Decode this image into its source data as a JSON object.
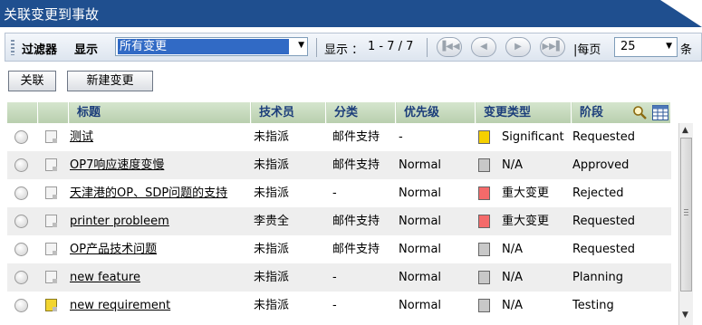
{
  "title": "关联变更到事故",
  "toolbar": {
    "filter_label": "过滤器",
    "show_label": "显示",
    "filter_value": "所有变更",
    "range_label": "显示 ：",
    "range_value": "1 - 7 / 7",
    "per_page_label": "|每页",
    "per_page_value": "25",
    "per_page_suffix": "条"
  },
  "actions": {
    "associate": "关联",
    "new_change": "新建变更"
  },
  "table": {
    "columns": [
      "标题",
      "技术员",
      "分类",
      "优先级",
      "变更类型",
      "阶段"
    ],
    "rows": [
      {
        "title": "测试",
        "tech": "未指派",
        "category": "邮件支持",
        "priority": "-",
        "type": "Significant",
        "type_color": "#f5d000",
        "stage": "Requested",
        "note": "plain"
      },
      {
        "title": "OP7响应速度变慢",
        "tech": "未指派",
        "category": "邮件支持",
        "priority": "Normal",
        "type": "N/A",
        "type_color": "#c8c8c8",
        "stage": "Approved",
        "note": "plain"
      },
      {
        "title": "天津港的OP、SDP问题的支持",
        "tech": "未指派",
        "category": "-",
        "priority": "Normal",
        "type": "重大变更",
        "type_color": "#f46a6a",
        "stage": "Rejected",
        "note": "plain"
      },
      {
        "title": "printer probleem",
        "tech": "李贵全",
        "category": "邮件支持",
        "priority": "Normal",
        "type": "重大变更",
        "type_color": "#f46a6a",
        "stage": "Requested",
        "note": "plain"
      },
      {
        "title": "OP产品技术问题",
        "tech": "未指派",
        "category": "邮件支持",
        "priority": "Normal",
        "type": "N/A",
        "type_color": "#c8c8c8",
        "stage": "Requested",
        "note": "plain"
      },
      {
        "title": "new feature",
        "tech": "未指派",
        "category": "-",
        "priority": "Normal",
        "type": "N/A",
        "type_color": "#c8c8c8",
        "stage": "Planning",
        "note": "plain"
      },
      {
        "title": "new requirement",
        "tech": "未指派",
        "category": "-",
        "priority": "Normal",
        "type": "N/A",
        "type_color": "#c8c8c8",
        "stage": "Testing",
        "note": "yellow"
      }
    ]
  },
  "icons": {
    "search": "search-icon",
    "columns": "column-chooser-icon"
  }
}
